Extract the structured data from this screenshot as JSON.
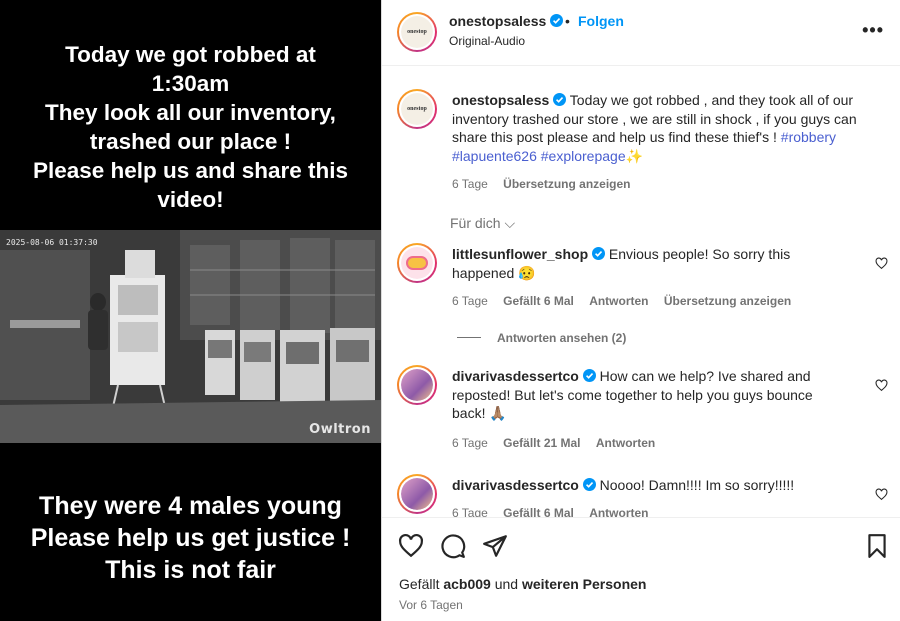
{
  "media": {
    "top_caption": "Today we got robbed at\n1:30am\nThey look all our inventory,\ntrashed our place !\nPlease help us and share this\nvideo!",
    "timestamp": "2025-08-06  01:37:30",
    "camera_brand": "Owltron",
    "bottom_caption": "They were 4 males young\nPlease help us get justice !\nThis is not fair"
  },
  "header": {
    "username": "onestopsaless",
    "separator": "•",
    "follow_label": "Folgen",
    "audio": "Original-Audio",
    "more_label": "•••"
  },
  "caption": {
    "username": "onestopsaless",
    "text": " Today we got robbed , and they took all of our inventory trashed our store , we are still in shock , if you guys can share this post please and help us find these thief's ! ",
    "tags": "#robbery #lapuente626 #explorepage✨",
    "age": "6 Tage",
    "translate": "Übersetzung anzeigen"
  },
  "for_you": "Für dich ⌵",
  "comments": [
    {
      "username": "littlesunflower_shop",
      "text": " Envious people! So sorry this happened 😥",
      "age": "6 Tage",
      "likes": "Gefällt 6 Mal",
      "reply": "Antworten",
      "translate": "Übersetzung anzeigen",
      "view_replies": "Antworten ansehen (2)"
    },
    {
      "username": "divarivasdessertco",
      "text": " How can we help? Ive shared and reposted! But let's come together to help you guys bounce back! 🙏🏽",
      "age": "6 Tage",
      "likes": "Gefällt 21 Mal",
      "reply": "Antworten"
    },
    {
      "username": "divarivasdessertco",
      "text": " Noooo! Damn!!!! Im so sorry!!!!!",
      "age": "6 Tage",
      "likes": "Gefällt 6 Mal",
      "reply": "Antworten"
    }
  ],
  "footer": {
    "liked_prefix": "Gefällt ",
    "liked_user": "acb009",
    "liked_mid": " und ",
    "liked_suffix": "weiteren Personen",
    "when": "Vor 6 Tagen"
  },
  "colors": {
    "accent": "#0095f6",
    "verified": "#0095f6",
    "muted": "#737373"
  }
}
